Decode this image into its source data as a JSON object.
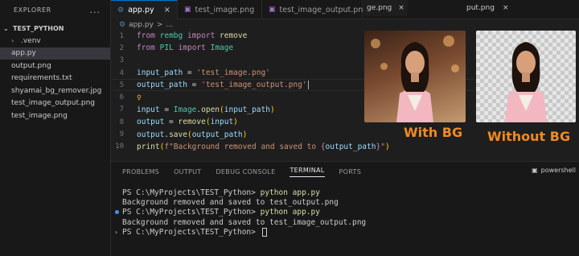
{
  "sidebar": {
    "header": "EXPLORER",
    "more": "...",
    "folder": "TEST_PYTHON",
    "items": [
      {
        "label": ".venv",
        "kind": "folder"
      },
      {
        "label": "app.py",
        "kind": "py",
        "active": true
      },
      {
        "label": "output.png",
        "kind": "img"
      },
      {
        "label": "requirements.txt",
        "kind": "txt"
      },
      {
        "label": "shyamai_bg_remover.jpg",
        "kind": "img"
      },
      {
        "label": "test_image_output.png",
        "kind": "img"
      },
      {
        "label": "test_image.png",
        "kind": "img"
      }
    ]
  },
  "tabs": [
    {
      "label": "app.py",
      "close": "×"
    },
    {
      "label": "test_image.png"
    },
    {
      "label": "test_image_output.png"
    },
    {
      "label": "ge.png"
    },
    {
      "label": "put.png"
    }
  ],
  "breadcrumb": {
    "file": "app.py",
    "sep": ">",
    "rest": "..."
  },
  "code": {
    "lines": [
      "1",
      "2",
      "3",
      "4",
      "5",
      "6",
      "7",
      "8",
      "9",
      "10"
    ],
    "l1": {
      "kw1": "from",
      "mod": "rembg",
      "kw2": "import",
      "name": "remove"
    },
    "l2": {
      "kw1": "from",
      "mod": "PIL",
      "kw2": "import",
      "name": "Image"
    },
    "l4": {
      "var": "input_path",
      "eq": " = ",
      "str": "'test_image.png'"
    },
    "l5": {
      "var": "output_path",
      "eq": " = ",
      "str": "'test_image_output.png'"
    },
    "l7": {
      "var": "input",
      "eq": " = ",
      "cls": "Image",
      "dot": ".",
      "fn": "open",
      "arg": "input_path"
    },
    "l8": {
      "var": "output",
      "eq": " = ",
      "fn": "remove",
      "arg": "input"
    },
    "l9": {
      "var": "output",
      "dot": ".",
      "fn": "save",
      "arg": "output_path"
    },
    "l10": {
      "fn": "print",
      "fpre": "f\"Background removed and saved to ",
      "fvar": "output_path",
      "fpost": "\""
    }
  },
  "labels": {
    "with_bg": "With BG",
    "without_bg": "Without BG"
  },
  "panel": {
    "tabs": [
      "PROBLEMS",
      "OUTPUT",
      "DEBUG CONSOLE",
      "TERMINAL",
      "PORTS"
    ],
    "active_tab": "TERMINAL",
    "shell": "powershell",
    "terminal": [
      {
        "prompt": "PS C:\\MyProjects\\TEST_Python> ",
        "cmd": "python app.py"
      },
      {
        "out": "Background removed and saved to test_output.png"
      },
      {
        "prompt": "PS C:\\MyProjects\\TEST_Python> ",
        "cmd": "python app.py"
      },
      {
        "out": "Background removed and saved to test_image_output.png"
      },
      {
        "prompt": "PS C:\\MyProjects\\TEST_Python> "
      }
    ]
  },
  "colors": {
    "accent": "#0078d4",
    "label": "#f08a24",
    "keyword": "#c586c0",
    "string": "#ce9178"
  }
}
